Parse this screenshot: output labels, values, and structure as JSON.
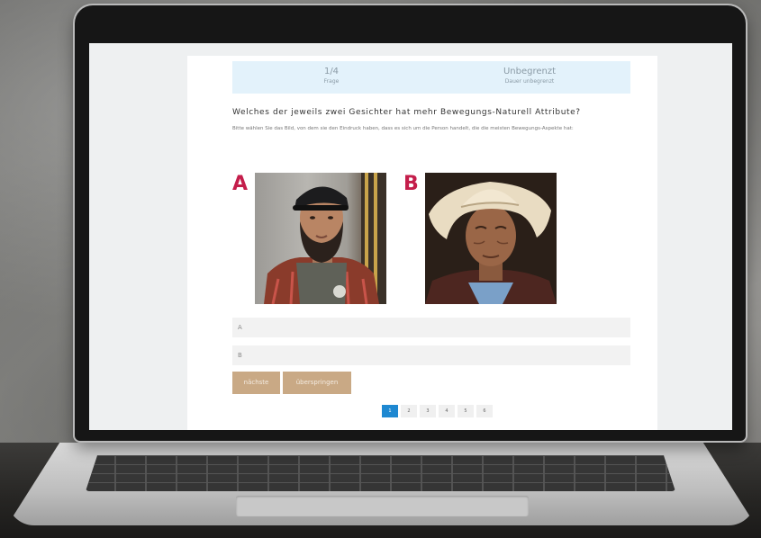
{
  "quiz": {
    "counter_value": "1/4",
    "counter_label": "Frage",
    "time_value": "Unbegrenzt",
    "time_label": "Dauer unbegrenzt",
    "question": "Welches der jeweils zwei Gesichter hat mehr Bewegungs-Naturell Attribute?",
    "hint": "Bitte wählen Sie das Bild, von dem sie den Eindruck haben, dass es sich um die Person handelt, die die meisten Bewegungs-Aspekte hat:",
    "image_labels": [
      "A",
      "B"
    ],
    "answers": [
      "A",
      "B"
    ],
    "buttons": {
      "next": "nächste",
      "skip": "überspringen"
    },
    "pages": [
      "1",
      "2",
      "3",
      "4",
      "5",
      "6"
    ],
    "active_page": "1"
  },
  "colors": {
    "accent_label": "#c41e4b",
    "info_bar": "#e3f2fb",
    "button": "#c9a985",
    "pager_active": "#1e88d1"
  }
}
